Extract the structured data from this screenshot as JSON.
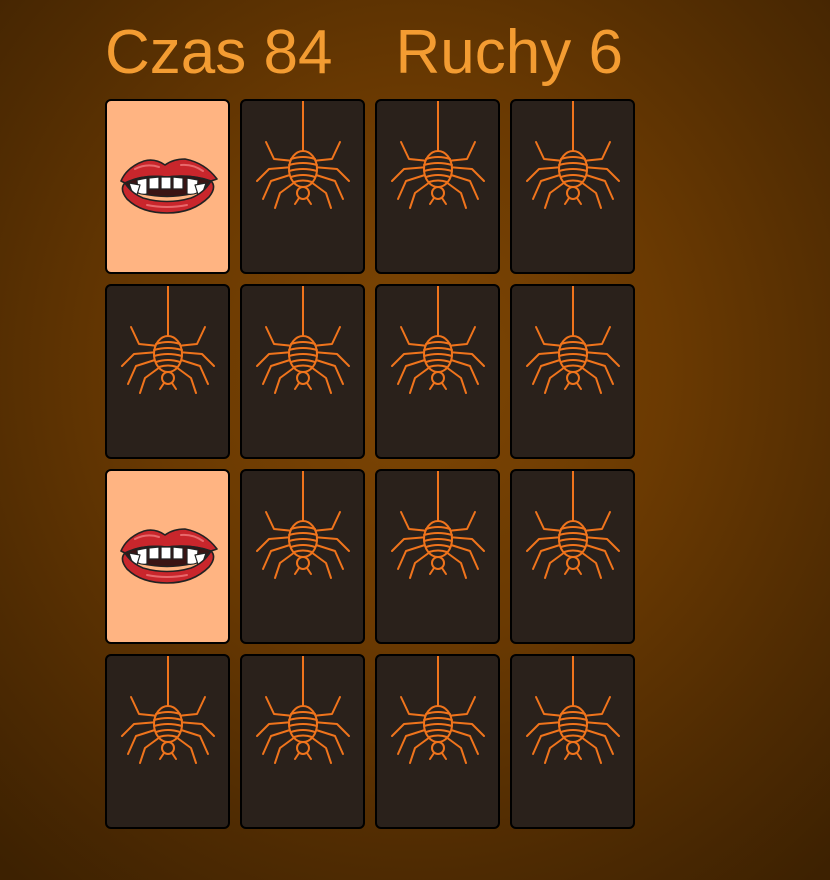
{
  "stats": {
    "time_label": "Czas",
    "time_value": "84",
    "moves_label": "Ruchy",
    "moves_value": "6"
  },
  "colors": {
    "text": "#f39c32",
    "card_back": "#2a211b",
    "card_face": "#ffb482",
    "spider": "#f0741c",
    "lips": "#c9262c"
  },
  "board": {
    "rows": 4,
    "cols": 4,
    "cards": [
      {
        "state": "face-up",
        "icon": "vampire-lips-icon"
      },
      {
        "state": "face-down",
        "icon": "spider-icon"
      },
      {
        "state": "face-down",
        "icon": "spider-icon"
      },
      {
        "state": "face-down",
        "icon": "spider-icon"
      },
      {
        "state": "face-down",
        "icon": "spider-icon"
      },
      {
        "state": "face-down",
        "icon": "spider-icon"
      },
      {
        "state": "face-down",
        "icon": "spider-icon"
      },
      {
        "state": "face-down",
        "icon": "spider-icon"
      },
      {
        "state": "face-up",
        "icon": "vampire-lips-icon"
      },
      {
        "state": "face-down",
        "icon": "spider-icon"
      },
      {
        "state": "face-down",
        "icon": "spider-icon"
      },
      {
        "state": "face-down",
        "icon": "spider-icon"
      },
      {
        "state": "face-down",
        "icon": "spider-icon"
      },
      {
        "state": "face-down",
        "icon": "spider-icon"
      },
      {
        "state": "face-down",
        "icon": "spider-icon"
      },
      {
        "state": "face-down",
        "icon": "spider-icon"
      }
    ]
  }
}
